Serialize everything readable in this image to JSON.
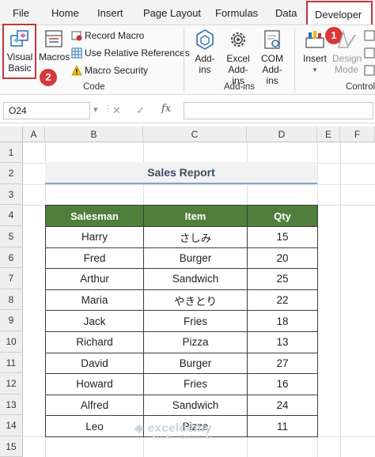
{
  "ribbon_tabs": [
    "File",
    "Home",
    "Insert",
    "Page Layout",
    "Formulas",
    "Data",
    "Developer"
  ],
  "active_tab": "Developer",
  "code_group": {
    "label": "Code",
    "visual_basic": "Visual Basic",
    "macros": "Macros",
    "record_macro": "Record Macro",
    "use_relative": "Use Relative References",
    "macro_security": "Macro Security"
  },
  "addins_group": {
    "label": "Add-ins",
    "addins": "Add-ins",
    "excel_addins": "Excel Add-ins",
    "com_addins": "COM Add-ins"
  },
  "controls_group": {
    "label": "Control",
    "insert": "Insert",
    "design_mode": "Design Mode"
  },
  "annotations": {
    "step1": "1",
    "step2": "2"
  },
  "formula_bar": {
    "name_box": "O24",
    "fx": "fx",
    "value": ""
  },
  "columns": [
    "A",
    "B",
    "C",
    "D",
    "E",
    "F"
  ],
  "rows": [
    "1",
    "2",
    "3",
    "4",
    "5",
    "6",
    "7",
    "8",
    "9",
    "10",
    "11",
    "12",
    "13",
    "14",
    "15"
  ],
  "report_title": "Sales Report",
  "table": {
    "headers": [
      "Salesman",
      "Item",
      "Qty"
    ],
    "rows": [
      [
        "Harry",
        "さしみ",
        "15"
      ],
      [
        "Fred",
        "Burger",
        "20"
      ],
      [
        "Arthur",
        "Sandwich",
        "25"
      ],
      [
        "Maria",
        "やきとり",
        "22"
      ],
      [
        "Jack",
        "Fries",
        "18"
      ],
      [
        "Richard",
        "Pizza",
        "13"
      ],
      [
        "David",
        "Burger",
        "27"
      ],
      [
        "Howard",
        "Fries",
        "16"
      ],
      [
        "Alfred",
        "Sandwich",
        "24"
      ],
      [
        "Leo",
        "Pizza",
        "11"
      ]
    ]
  },
  "watermark": {
    "name": "exceldemy",
    "tagline": "EXCEL · DATA · BI"
  },
  "colors": {
    "header_green": "#4f7f3a",
    "highlight_red": "#c0393b",
    "title_underline": "#7fa3cf"
  }
}
